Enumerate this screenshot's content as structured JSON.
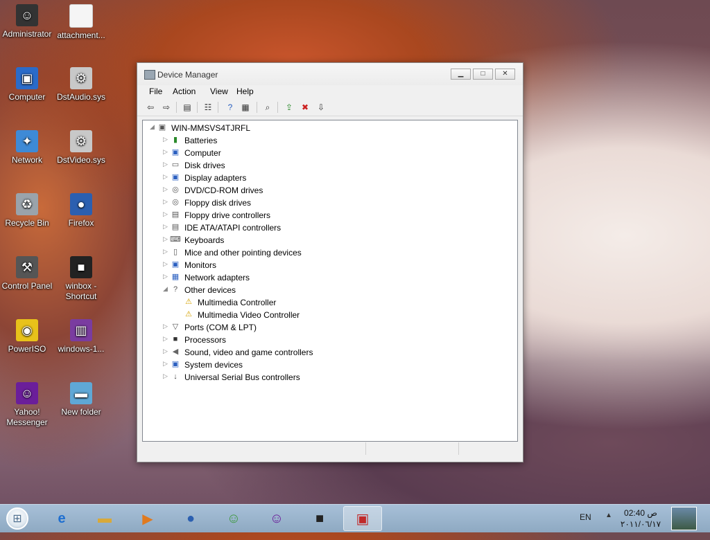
{
  "desktop": {
    "icons": [
      {
        "label": "Administrator",
        "icon": "user-icon",
        "color": "#333333"
      },
      {
        "label": "attachment...",
        "icon": "file-icon",
        "color": "#f5f5f5"
      },
      {
        "label": "Computer",
        "icon": "computer-icon",
        "color": "#2a6bc9"
      },
      {
        "label": "DstAudio.sys",
        "icon": "gear-file-icon",
        "color": "#c8c8c8"
      },
      {
        "label": "Network",
        "icon": "network-icon",
        "color": "#3e8ad6"
      },
      {
        "label": "DstVideo.sys",
        "icon": "gear-file-icon",
        "color": "#c8c8c8"
      },
      {
        "label": "Recycle Bin",
        "icon": "recycle-bin-icon",
        "color": "#9aa3ab"
      },
      {
        "label": "Firefox",
        "icon": "firefox-icon",
        "color": "#2b5fb0"
      },
      {
        "label": "Control Panel",
        "icon": "control-panel-icon",
        "color": "#555555"
      },
      {
        "label": "winbox - Shortcut",
        "icon": "winbox-icon",
        "color": "#222222"
      },
      {
        "label": "PowerISO",
        "icon": "poweriso-icon",
        "color": "#e8c21a"
      },
      {
        "label": "windows-1...",
        "icon": "winrar-icon",
        "color": "#7a3ca0"
      },
      {
        "label": "Yahoo! Messenger",
        "icon": "yahoo-messenger-icon",
        "color": "#6b1e9a"
      },
      {
        "label": "New folder",
        "icon": "folder-icon",
        "color": "#5fa8d6"
      }
    ]
  },
  "window": {
    "title": "Device Manager",
    "menu": [
      "File",
      "Action",
      "View",
      "Help"
    ],
    "tree": {
      "root": "WIN-MMSVS4TJRFL",
      "categories": [
        {
          "label": "Batteries",
          "icon": "battery-icon"
        },
        {
          "label": "Computer",
          "icon": "computer-icon"
        },
        {
          "label": "Disk drives",
          "icon": "disk-drive-icon"
        },
        {
          "label": "Display adapters",
          "icon": "display-adapter-icon"
        },
        {
          "label": "DVD/CD-ROM drives",
          "icon": "dvd-drive-icon"
        },
        {
          "label": "Floppy disk drives",
          "icon": "floppy-drive-icon"
        },
        {
          "label": "Floppy drive controllers",
          "icon": "floppy-controller-icon"
        },
        {
          "label": "IDE ATA/ATAPI controllers",
          "icon": "ide-controller-icon"
        },
        {
          "label": "Keyboards",
          "icon": "keyboard-icon"
        },
        {
          "label": "Mice and other pointing devices",
          "icon": "mouse-icon"
        },
        {
          "label": "Monitors",
          "icon": "monitor-icon"
        },
        {
          "label": "Network adapters",
          "icon": "network-adapter-icon"
        },
        {
          "label": "Other devices",
          "icon": "unknown-device-icon",
          "expanded": true,
          "children": [
            {
              "label": "Multimedia Controller",
              "icon": "warning-device-icon"
            },
            {
              "label": "Multimedia Video Controller",
              "icon": "warning-device-icon"
            }
          ]
        },
        {
          "label": "Ports (COM & LPT)",
          "icon": "port-icon"
        },
        {
          "label": "Processors",
          "icon": "processor-icon"
        },
        {
          "label": "Sound, video and game controllers",
          "icon": "sound-icon"
        },
        {
          "label": "System devices",
          "icon": "system-device-icon"
        },
        {
          "label": "Universal Serial Bus controllers",
          "icon": "usb-icon"
        }
      ]
    }
  },
  "taskbar": {
    "apps": [
      {
        "name": "internet-explorer",
        "icon": "internet-explorer-icon"
      },
      {
        "name": "file-explorer",
        "icon": "folder-icon"
      },
      {
        "name": "media-player",
        "icon": "media-player-icon"
      },
      {
        "name": "firefox",
        "icon": "firefox-icon"
      },
      {
        "name": "messenger",
        "icon": "people-icon"
      },
      {
        "name": "yahoo-messenger",
        "icon": "yahoo-messenger-icon"
      },
      {
        "name": "winbox",
        "icon": "winbox-icon"
      },
      {
        "name": "device-manager",
        "icon": "toolbox-icon",
        "active": true
      }
    ],
    "language": "EN",
    "time": "02:40 ص",
    "date": "٢٠١١/٠٦/١٧"
  }
}
